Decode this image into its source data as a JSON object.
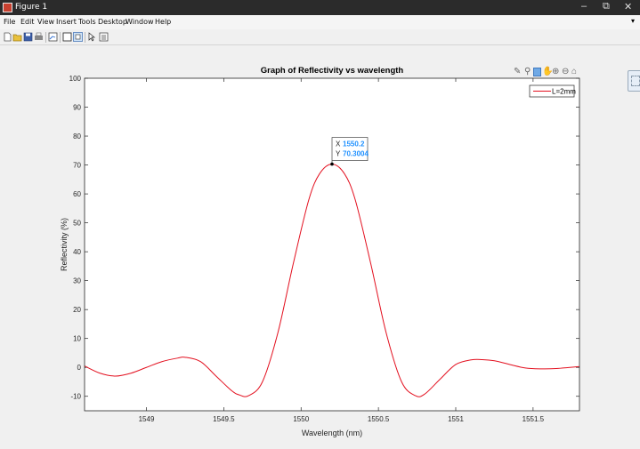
{
  "window": {
    "title": "Figure 1",
    "minimize": "–",
    "restore": "⧉",
    "close": "✕"
  },
  "menu": [
    "File",
    "Edit",
    "View",
    "Insert",
    "Tools",
    "Desktop",
    "Window",
    "Help"
  ],
  "menu_arrow": "▾",
  "toolbar": [
    "new-figure-icon",
    "open-file-icon",
    "save-icon",
    "print-icon",
    "link-plot-icon",
    "hide-plot-tools-icon",
    "show-plot-tools-icon",
    "edit-plot-pointer-icon",
    "insert-legend-icon"
  ],
  "axes_toolbar": [
    "brush-icon",
    "data-cursor-icon",
    "rotate-icon",
    "pan-icon",
    "zoom-in-icon",
    "zoom-out-icon",
    "home-icon"
  ],
  "colors": {
    "line": "#e3101f",
    "datatip_value": "#1e90ff",
    "axes_bg": "#ffffff",
    "figure_bg": "#f0f0f0"
  },
  "chart_data": {
    "type": "line",
    "title": "Graph of Reflectivity vs wavelength",
    "xlabel": "Wavelength (nm)",
    "ylabel": "Reflectivity (%)",
    "xlim": [
      1548.6,
      1551.8
    ],
    "ylim": [
      -15,
      100
    ],
    "xticks": [
      1549,
      1549.5,
      1550,
      1550.5,
      1551,
      1551.5
    ],
    "xtick_labels": [
      "1549",
      "1549.5",
      "1550",
      "1550.5",
      "1551",
      "1551.5"
    ],
    "yticks": [
      -10,
      0,
      10,
      20,
      30,
      40,
      50,
      60,
      70,
      80,
      90,
      100
    ],
    "ytick_labels": [
      "-10",
      "0",
      "10",
      "20",
      "30",
      "40",
      "50",
      "60",
      "70",
      "80",
      "90",
      "100"
    ],
    "legend": {
      "position": "top-right",
      "entries": [
        "L=2mm"
      ]
    },
    "grid": false,
    "series": [
      {
        "name": "L=2mm",
        "color": "#e3101f",
        "x": [
          1548.6,
          1548.7,
          1548.8,
          1548.9,
          1549.0,
          1549.1,
          1549.2,
          1549.25,
          1549.35,
          1549.45,
          1549.55,
          1549.6,
          1549.66,
          1549.75,
          1549.85,
          1549.95,
          1550.05,
          1550.12,
          1550.2,
          1550.28,
          1550.35,
          1550.45,
          1550.55,
          1550.65,
          1550.74,
          1550.8,
          1550.9,
          1551.0,
          1551.1,
          1551.17,
          1551.25,
          1551.35,
          1551.45,
          1551.55,
          1551.65,
          1551.8
        ],
        "y": [
          0.5,
          -2,
          -3,
          -2,
          0,
          2,
          3.2,
          3.5,
          2,
          -3,
          -8,
          -9.5,
          -9.8,
          -5,
          12,
          36,
          58,
          67,
          70.3,
          67,
          58,
          36,
          12,
          -5,
          -9.8,
          -9.2,
          -4,
          1,
          2.6,
          2.7,
          2.3,
          1,
          -0.2,
          -0.5,
          -0.4,
          0.3
        ]
      }
    ],
    "datatip": {
      "x_label": "X",
      "x_value": "1550.2",
      "y_label": "Y",
      "y_value": "70.3004",
      "x": 1550.2,
      "y": 70.3004
    }
  }
}
